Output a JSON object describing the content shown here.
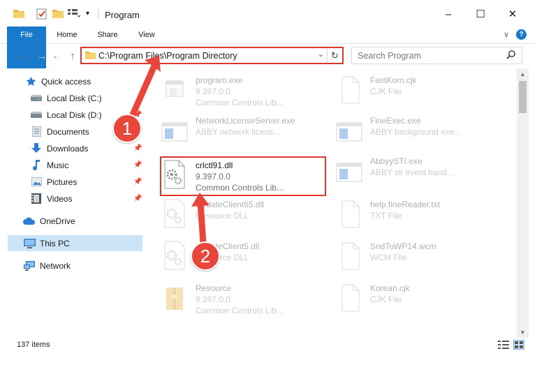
{
  "window": {
    "title": "Program",
    "minimize": "–",
    "maximize": "☐",
    "close": "✕",
    "ribbon_expand": "∨",
    "help": "?"
  },
  "ribbon": {
    "tabs": [
      "File",
      "Home",
      "Share",
      "View"
    ]
  },
  "address_bar": {
    "path": "C:\\Program Files\\Program Directory"
  },
  "search": {
    "placeholder": "Search Program"
  },
  "sidebar": {
    "items": [
      {
        "label": "Quick access",
        "icon": "star-icon"
      },
      {
        "label": "Local Disk (C:)",
        "icon": "drive-icon"
      },
      {
        "label": "Local Disk (D:)",
        "icon": "drive-icon"
      },
      {
        "label": "Documents",
        "icon": "documents-icon"
      },
      {
        "label": "Downloads",
        "icon": "download-icon"
      },
      {
        "label": "Music",
        "icon": "music-icon"
      },
      {
        "label": "Pictures",
        "icon": "pictures-icon"
      },
      {
        "label": "Videos",
        "icon": "videos-icon"
      },
      {
        "label": "OneDrive",
        "icon": "cloud-icon"
      },
      {
        "label": "This PC",
        "icon": "computer-icon"
      },
      {
        "label": "Network",
        "icon": "network-icon"
      }
    ]
  },
  "files": [
    {
      "name": "program.exe",
      "line1": "9.397.0.0",
      "line2": "Common Controls Lib...",
      "icon": "exe-icon"
    },
    {
      "name": "FastKorn.cjk",
      "line1": "CJK File",
      "line2": "",
      "icon": "blank-file-icon"
    },
    {
      "name": "NetworkLicenseServer.exe",
      "line1": "ABBY network licens...",
      "line2": "",
      "icon": "window-exe-icon"
    },
    {
      "name": "FineExec.exe",
      "line1": "ABBY background exe...",
      "line2": "",
      "icon": "window-exe-icon"
    },
    {
      "name": "crlctl91.dll",
      "line1": "9.397.0.0",
      "line2": "Common Controls Lib...",
      "icon": "dll-icon"
    },
    {
      "name": "AbbyySTI.exe",
      "line1": "ABBY sti event hand...",
      "line2": "",
      "icon": "window-exe-icon"
    },
    {
      "name": "UpdateClient65.dll",
      "line1": "Resource DLL",
      "line2": "",
      "icon": "dll-icon"
    },
    {
      "name": "help.fineReader.txt",
      "line1": "TXT File",
      "line2": "",
      "icon": "blank-file-icon"
    },
    {
      "name": "UpdateClient5.dll",
      "line1": "Resource DLL",
      "line2": "",
      "icon": "dll-icon"
    },
    {
      "name": "SndToWP14.wcm",
      "line1": "WCM File",
      "line2": "",
      "icon": "blank-file-icon"
    },
    {
      "name": "Resource",
      "line1": "9.397.0.0",
      "line2": "Common Controls Lib...",
      "icon": "archive-icon"
    },
    {
      "name": "Korean.cjk",
      "line1": "CJK File",
      "line2": "",
      "icon": "blank-file-icon"
    }
  ],
  "status": {
    "item_count": "137 items"
  },
  "annotations": {
    "step1": "1",
    "step2": "2",
    "color": "#e8463a"
  }
}
